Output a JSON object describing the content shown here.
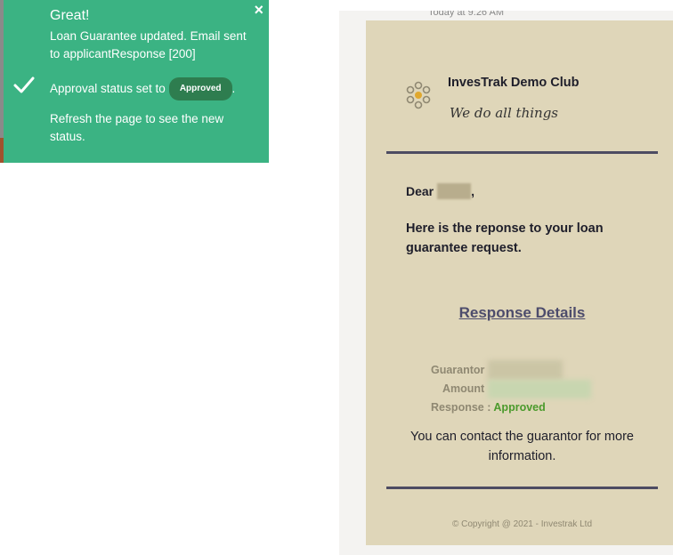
{
  "toast": {
    "title": "Great!",
    "message_line1": "Loan Guarantee updated. Email sent to applicantResponse [200]",
    "status_prefix": "Approval status set to",
    "status_badge": "Approved",
    "status_suffix": ".",
    "refresh_text": "Refresh the page to see the new status.",
    "close_glyph": "×",
    "color": "#3bb383"
  },
  "email": {
    "top_text": "Today at 9:26 AM",
    "club_name": "InvesTrak Demo Club",
    "tagline": "We do all things",
    "greeting": "Dear",
    "greeting_suffix": ",",
    "intro": "Here is the reponse to your loan guarantee request.",
    "section_title": "Response Details",
    "details": {
      "guarantor_label": "Guarantor",
      "amount_label": "Amount",
      "response_label": "Response :",
      "response_value": "Approved"
    },
    "contact": "You can contact the guarantor for more information.",
    "copyright": "© Copyright @ 2021 - Investrak Ltd",
    "card_color": "#dfd6b9",
    "divider_color": "#4d4c62"
  }
}
